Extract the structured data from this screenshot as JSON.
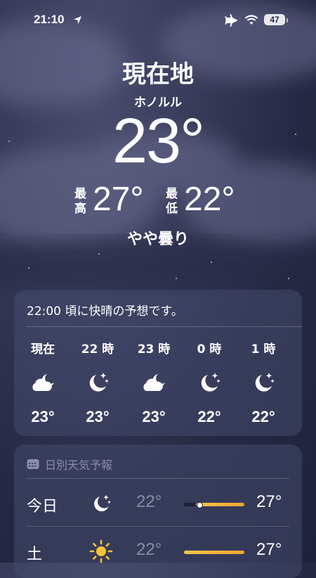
{
  "status_bar": {
    "time": "21:10",
    "battery": "47"
  },
  "location": {
    "title": "現在地",
    "subtitle": "ホノルル"
  },
  "current": {
    "temperature": "23°",
    "high_label_top": "最",
    "high_label_bottom": "高",
    "high": "27°",
    "low_label_top": "最",
    "low_label_bottom": "低",
    "low": "22°",
    "condition": "やや曇り"
  },
  "hourly": {
    "summary": "22:00 頃に快晴の予想です。",
    "items": [
      {
        "label": "現在",
        "icon": "cloud-moon-icon",
        "temp": "23°"
      },
      {
        "label": "22 時",
        "icon": "moon-stars-icon",
        "temp": "23°"
      },
      {
        "label": "23 時",
        "icon": "cloud-moon-icon",
        "temp": "23°"
      },
      {
        "label": "0 時",
        "icon": "moon-stars-icon",
        "temp": "22°"
      },
      {
        "label": "1 時",
        "icon": "moon-stars-icon",
        "temp": "22°"
      }
    ]
  },
  "daily": {
    "header": "日別天気予報",
    "items": [
      {
        "day": "今日",
        "icon": "moon-stars-icon",
        "low": "22°",
        "high": "27°",
        "range_start": 0.2,
        "range_end": 1.0,
        "current": 0.25
      },
      {
        "day": "土",
        "icon": "sun-icon",
        "low": "22°",
        "high": "27°",
        "range_start": 0.0,
        "range_end": 1.0
      }
    ]
  },
  "colors": {
    "accent_orange": "#f2a333",
    "muted_text": "#8a8daa",
    "card_bg": "#464a6e"
  }
}
